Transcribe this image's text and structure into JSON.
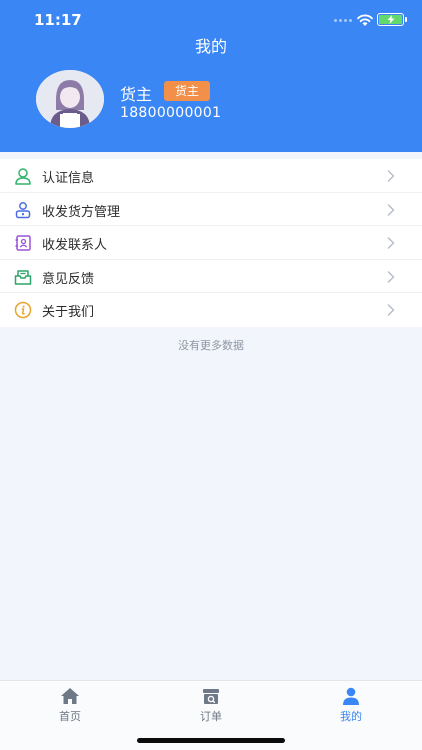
{
  "status_bar": {
    "time": "11:17"
  },
  "header": {
    "title": "我的",
    "user_name": "货主",
    "role_badge": "货主",
    "phone": "18800000001"
  },
  "menu": {
    "items": [
      {
        "label": "认证信息",
        "icon": "person-icon",
        "color": "#31b46b"
      },
      {
        "label": "收发货方管理",
        "icon": "user-management-icon",
        "color": "#4a6de5"
      },
      {
        "label": "收发联系人",
        "icon": "contacts-book-icon",
        "color": "#9a52d8"
      },
      {
        "label": "意见反馈",
        "icon": "feedback-inbox-icon",
        "color": "#2fa36a"
      },
      {
        "label": "关于我们",
        "icon": "info-icon",
        "color": "#e9a42c"
      }
    ]
  },
  "footer_note": "没有更多数据",
  "tab_bar": {
    "tabs": [
      {
        "label": "首页",
        "icon": "home-icon"
      },
      {
        "label": "订单",
        "icon": "order-box-icon"
      },
      {
        "label": "我的",
        "icon": "profile-icon",
        "active": true
      }
    ]
  },
  "colors": {
    "brand_blue": "#3a86f4",
    "badge_orange": "#f28f48",
    "background": "#f2f5fb"
  }
}
